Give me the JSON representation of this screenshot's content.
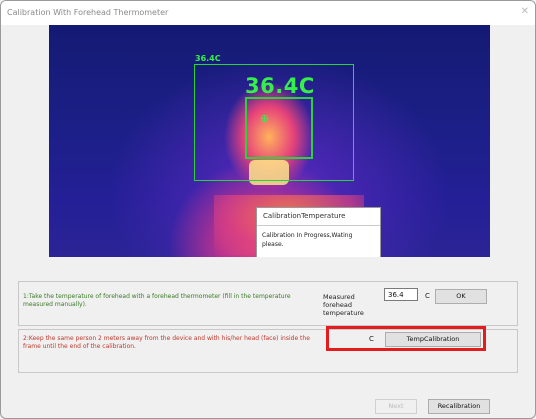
{
  "window": {
    "title": "Calibration With Forehead Thermometer"
  },
  "thermal_view": {
    "frame_label": "36.4C",
    "reading": "36.4C"
  },
  "popup": {
    "title": "CalibrationTemperature",
    "message": "Calibration In Progress,Wating please."
  },
  "step1": {
    "text": "1:Take the temperature of forehead with a forehead thermometer (fill in the temperature measured manually).",
    "measured_label": "Measured forehead temperature",
    "value": "36.4",
    "unit": "C",
    "ok_label": "OK"
  },
  "step2": {
    "text": "2:Keep the same person 2 meters away from the device and with his/her head (face) inside the frame until the end of the calibration.",
    "unit": "C",
    "button_label": "TempCalibration"
  },
  "footer": {
    "next_label": "Next",
    "recalibration_label": "Recalibration"
  },
  "colors": {
    "highlight": "#e31d1d",
    "detect_green": "#35f04a",
    "step1_text": "#3a7a25",
    "step2_text": "#c0392b"
  }
}
